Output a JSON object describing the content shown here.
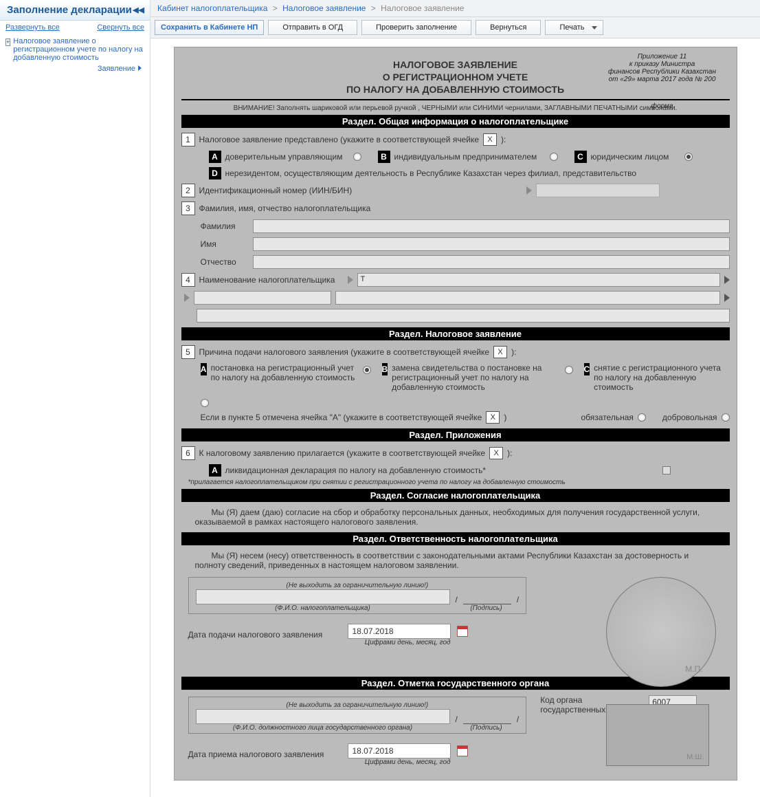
{
  "sidebar": {
    "title": "Заполнение декларации",
    "expand_all": "Развернуть все",
    "collapse_all": "Свернуть все",
    "tree_root": "Налоговое заявление о регистрационном учете по налогу на добавленную стоимость",
    "tree_leaf": "Заявление"
  },
  "breadcrumb": {
    "a": "Кабинет налогоплательщика",
    "b": "Налоговое заявление",
    "c": "Налоговое заявление"
  },
  "toolbar": {
    "save": "Сохранить в Кабинете НП",
    "send": "Отправить в ОГД",
    "check": "Проверить заполнение",
    "back": "Вернуться",
    "print": "Печать"
  },
  "anno": {
    "l1": "Приложение 11",
    "l2": "к приказу Министра",
    "l3": "финансов Республики Казахстан",
    "l4": "от «29» марта 2017 года № 200",
    "forma": "форма"
  },
  "title": {
    "l1": "НАЛОГОВОЕ ЗАЯВЛЕНИЕ",
    "l2": "О РЕГИСТРАЦИОННОМ УЧЕТЕ",
    "l3": "ПО НАЛОГУ НА ДОБАВЛЕННУЮ СТОИМОСТЬ"
  },
  "warn": "ВНИМАНИЕ! Заполнять шариковой или перьевой ручкой , ЧЕРНЫМИ или СИНИМИ чернилами,  ЗАГЛАВНЫМИ ПЕЧАТНЫМИ символами.",
  "sections": {
    "info": "Раздел. Общая информация о налогоплательщике",
    "app": "Раздел. Налоговое заявление",
    "attach": "Раздел. Приложения",
    "consent": "Раздел. Согласие налогоплательщика",
    "resp": "Раздел. Ответственность налогоплательщика",
    "gov": "Раздел. Отметка государственного органа"
  },
  "q1": {
    "text": "Налоговое заявление представлено (укажите в соответствующей ячейке",
    "x": "X",
    "close": "):",
    "A": "доверительным управляющим",
    "B": "индивидуальным предпринимателем",
    "C": "юридическим лицом",
    "D": "нерезидентом, осуществляющим деятельность в Республике Казахстан через филиал, представительство"
  },
  "q2": {
    "text": "Идентификационный номер (ИИН/БИН)"
  },
  "q3": {
    "text": "Фамилия, имя, отчество налогоплательщика",
    "lastname": "Фамилия",
    "firstname": "Имя",
    "patronymic": "Отчество"
  },
  "q4": {
    "text": "Наименование налогоплательщика",
    "val": "Т"
  },
  "q5": {
    "text": "Причина подачи налогового заявления (укажите в соответствующей ячейке",
    "x": "X",
    "close": "):",
    "A": "постановка на регистрационный учет по налогу на добавленную стоимость",
    "B": "замена свидетельства о постановке на регистрационный учет по налогу на добавленную стоимость",
    "C": "снятие с регистрационного учета по налогу на добавленную стоимость",
    "sub": "Если в пункте 5 отмечена ячейка   \"А\"   (укажите в соответствующей ячейке",
    "sub_x": "X",
    "sub_close": ")",
    "mand": "обязательная",
    "vol": "добровольная"
  },
  "q6": {
    "text": "К налоговому заявлению прилагается  (укажите в соответствующей ячейке",
    "x": "X",
    "close": "):",
    "A": "ликвидационная декларация по налогу на добавленную стоимость*",
    "note": "*прилагается налогоплательщиком при снятии с регистрационного учета по налогу на добавленную стоимость"
  },
  "consent_text": "Мы (Я) даем (даю) согласие на сбор и обработку персональных данных, необходимых для получения государственной услуги, оказываемой в рамках настоящего налогового заявления.",
  "resp_text": "Мы (Я) несем (несу) ответственность в соответствии с законодательными актами Республики Казахстан за достоверность и полноту сведений, приведенных в настоящем налоговом заявлении.",
  "sign": {
    "boundary": "(Не выходить за ограничительную линию!)",
    "fio": "(Ф.И.О. налогоплательщика)",
    "fio_gov": "(Ф.И.О. должностного лица государственного органа)",
    "sig": "(Подпись)",
    "slash": "/",
    "date_submit_lbl": "Дата подачи налогового заявления",
    "date_submit_val": "18.07.2018",
    "date_accept_lbl": "Дата приема налогового заявления",
    "date_accept_val": "18.07.2018",
    "date_hint": "Цифрами день, месяц, год"
  },
  "gov": {
    "code_lbl": "Код органа государственных доходов",
    "code_val": "6007"
  },
  "stamp_mp": "М.П.",
  "stamp_msh": "М.Ш."
}
